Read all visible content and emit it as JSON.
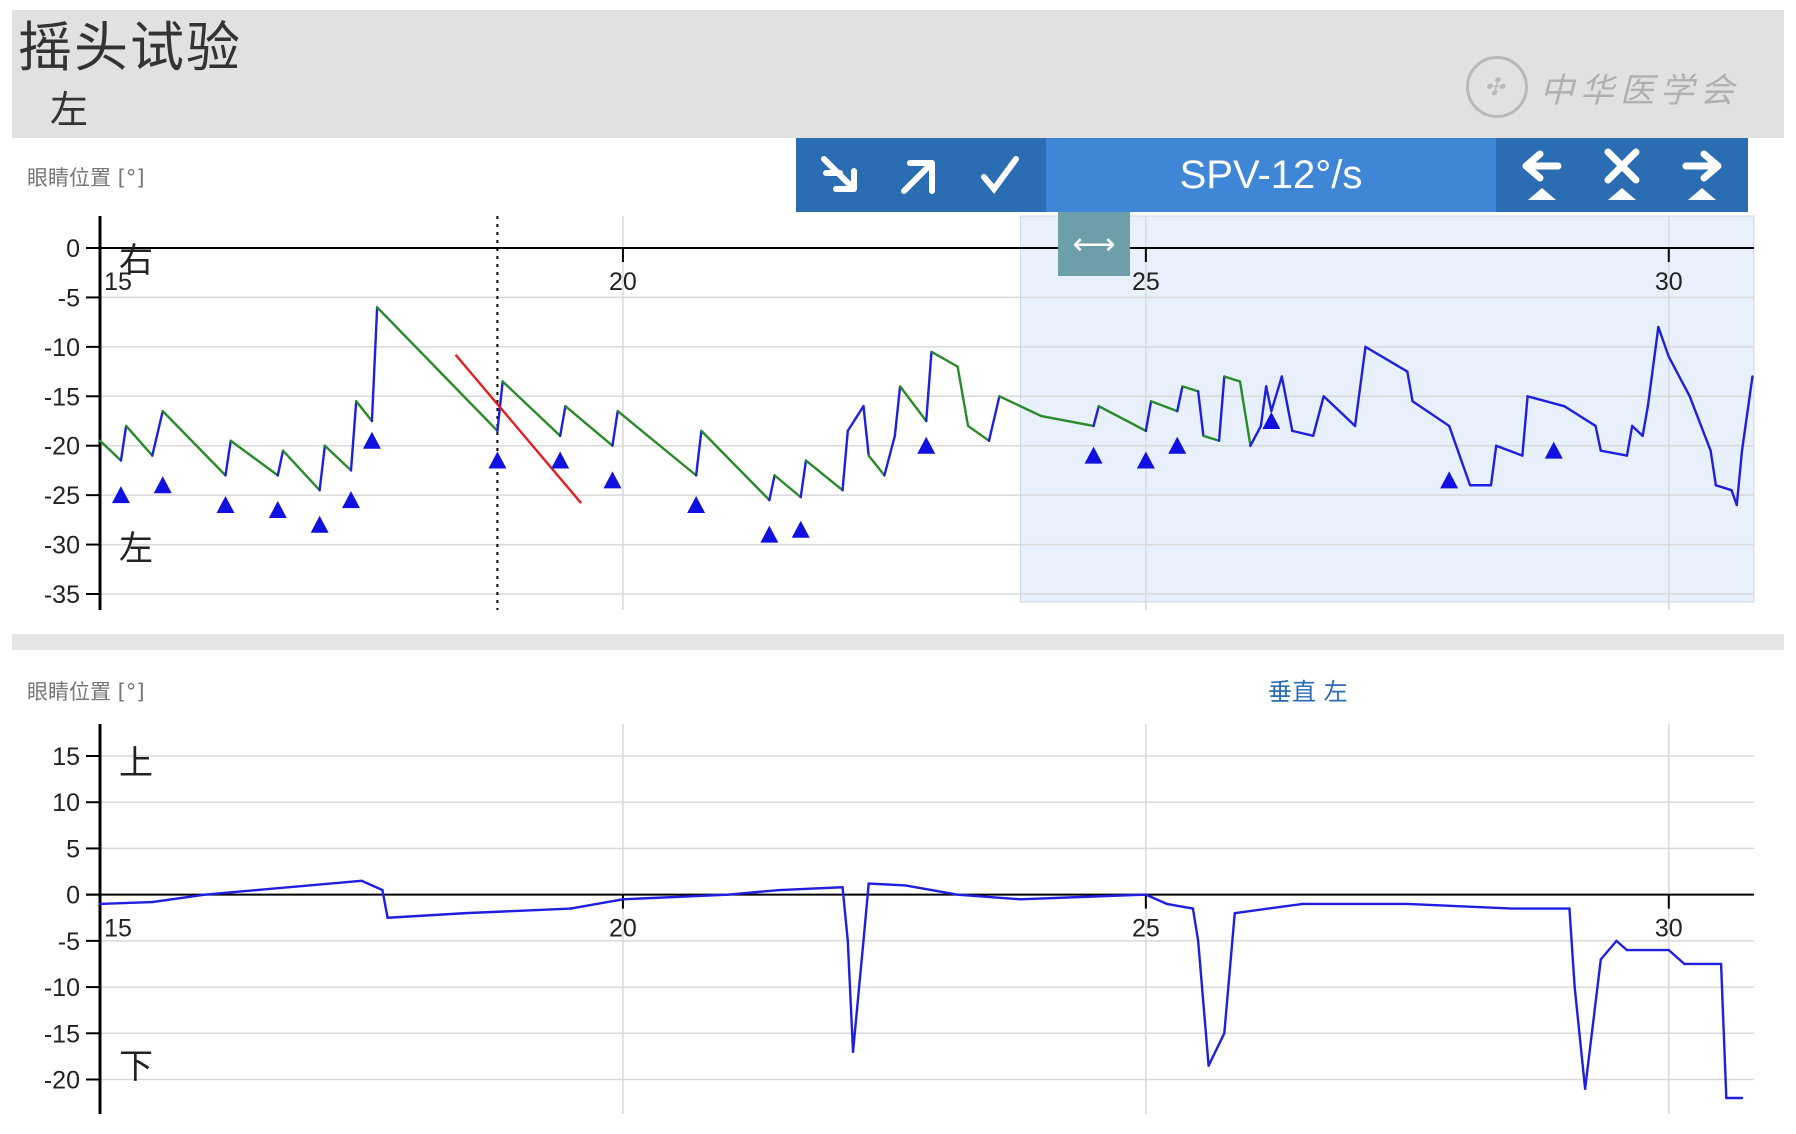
{
  "header": {
    "title": "摇头试验",
    "subtitle": "左",
    "watermark": "中华医学会"
  },
  "toolbar": {
    "spv_label": "SPV-12°/s",
    "left_icons": [
      "arrow-down-left-icon",
      "arrow-up-left-icon",
      "check-icon"
    ],
    "right_icons": [
      "arrow-left-icon",
      "close-icon",
      "arrow-right-icon"
    ],
    "handle_icon": "resize-horizontal-icon"
  },
  "colors": {
    "trace": "#1f1fe0",
    "slow_phase": "#2a8a2a",
    "fit_line": "#e02020",
    "selection": "#e8f1fb",
    "toolbar": "#2b6db3"
  },
  "chart_data": [
    {
      "type": "line",
      "panel": "horizontal",
      "ylabel": "眼睛位置 [°]",
      "ylim": [
        -35,
        0
      ],
      "yticks": [
        0,
        -5,
        -10,
        -15,
        -20,
        -25,
        -30,
        -35
      ],
      "xlim": [
        15,
        30.7
      ],
      "xticks": [
        15,
        20,
        25,
        30
      ],
      "direction_labels": {
        "top": "右",
        "bottom": "左"
      },
      "selection": [
        23.8,
        30.7
      ],
      "marker_line_x": 18.8,
      "fit_line": [
        [
          18.4,
          -10.8
        ],
        [
          19.6,
          -25.8
        ]
      ],
      "triangle_markers": [
        [
          15.2,
          -25
        ],
        [
          15.6,
          -24
        ],
        [
          16.2,
          -26
        ],
        [
          16.7,
          -26.5
        ],
        [
          17.1,
          -28
        ],
        [
          17.4,
          -25.5
        ],
        [
          17.6,
          -19.5
        ],
        [
          18.8,
          -21.5
        ],
        [
          19.4,
          -21.5
        ],
        [
          19.9,
          -23.5
        ],
        [
          20.7,
          -26
        ],
        [
          21.4,
          -29
        ],
        [
          21.7,
          -28.5
        ],
        [
          22.9,
          -20
        ],
        [
          24.5,
          -21
        ],
        [
          25.0,
          -21.5
        ],
        [
          25.3,
          -20
        ],
        [
          26.2,
          -17.5
        ],
        [
          27.9,
          -23.5
        ],
        [
          28.9,
          -20.5
        ]
      ],
      "series": [
        {
          "values": [
            [
              15.0,
              -19.5
            ],
            [
              15.2,
              -21.5
            ],
            [
              15.25,
              -18
            ],
            [
              15.5,
              -21
            ],
            [
              15.6,
              -16.5
            ],
            [
              16.2,
              -23
            ],
            [
              16.25,
              -19.5
            ],
            [
              16.7,
              -23
            ],
            [
              16.75,
              -20.5
            ],
            [
              17.1,
              -24.5
            ],
            [
              17.15,
              -20
            ],
            [
              17.4,
              -22.5
            ],
            [
              17.45,
              -15.5
            ],
            [
              17.6,
              -17.5
            ],
            [
              17.65,
              -6
            ],
            [
              18.8,
              -18.5
            ],
            [
              18.85,
              -13.5
            ],
            [
              19.4,
              -19
            ],
            [
              19.45,
              -16
            ],
            [
              19.9,
              -20
            ],
            [
              19.95,
              -16.5
            ],
            [
              20.7,
              -23
            ],
            [
              20.75,
              -18.5
            ],
            [
              21.4,
              -25.5
            ],
            [
              21.45,
              -23
            ],
            [
              21.7,
              -25.2
            ],
            [
              21.75,
              -21.5
            ],
            [
              22.1,
              -24.5
            ],
            [
              22.15,
              -18.5
            ],
            [
              22.3,
              -16
            ],
            [
              22.35,
              -21
            ],
            [
              22.5,
              -23
            ],
            [
              22.6,
              -19
            ],
            [
              22.65,
              -14
            ],
            [
              22.9,
              -17.5
            ],
            [
              22.95,
              -10.5
            ],
            [
              23.2,
              -12
            ],
            [
              23.3,
              -18
            ],
            [
              23.5,
              -19.5
            ],
            [
              23.6,
              -15
            ],
            [
              24.0,
              -17
            ],
            [
              24.5,
              -18
            ],
            [
              24.55,
              -16
            ],
            [
              25.0,
              -18.5
            ],
            [
              25.05,
              -15.5
            ],
            [
              25.3,
              -16.5
            ],
            [
              25.35,
              -14
            ],
            [
              25.5,
              -14.5
            ],
            [
              25.55,
              -19
            ],
            [
              25.7,
              -19.5
            ],
            [
              25.75,
              -13
            ],
            [
              25.9,
              -13.5
            ],
            [
              26.0,
              -20
            ],
            [
              26.1,
              -18
            ],
            [
              26.15,
              -14
            ],
            [
              26.2,
              -16.5
            ],
            [
              26.3,
              -13
            ],
            [
              26.4,
              -18.5
            ],
            [
              26.6,
              -19
            ],
            [
              26.7,
              -15
            ],
            [
              26.9,
              -17
            ],
            [
              27.0,
              -18
            ],
            [
              27.1,
              -10
            ],
            [
              27.5,
              -12.5
            ],
            [
              27.55,
              -15.5
            ],
            [
              27.9,
              -18
            ],
            [
              28.1,
              -24
            ],
            [
              28.3,
              -24
            ],
            [
              28.35,
              -20
            ],
            [
              28.6,
              -21
            ],
            [
              28.65,
              -15
            ],
            [
              29.0,
              -16
            ],
            [
              29.3,
              -18
            ],
            [
              29.35,
              -20.5
            ],
            [
              29.6,
              -21
            ],
            [
              29.65,
              -18
            ],
            [
              29.75,
              -19
            ],
            [
              29.8,
              -16
            ],
            [
              29.9,
              -8
            ],
            [
              30.0,
              -11
            ],
            [
              30.2,
              -15
            ],
            [
              30.4,
              -20.5
            ],
            [
              30.45,
              -24
            ],
            [
              30.6,
              -24.5
            ],
            [
              30.65,
              -26
            ],
            [
              30.7,
              -20.5
            ],
            [
              30.8,
              -13
            ]
          ]
        }
      ]
    },
    {
      "type": "line",
      "panel": "vertical",
      "title": "垂直 左",
      "ylabel": "眼睛位置 [°]",
      "ylim": [
        -22,
        15
      ],
      "yticks": [
        15,
        10,
        5,
        0,
        -5,
        -10,
        -15,
        -20
      ],
      "xlim": [
        15,
        30.7
      ],
      "xticks": [
        15,
        20,
        25,
        30
      ],
      "direction_labels": {
        "top": "上",
        "bottom": "下"
      },
      "series": [
        {
          "values": [
            [
              15.0,
              -1
            ],
            [
              15.5,
              -0.8
            ],
            [
              16.0,
              0
            ],
            [
              16.5,
              0.5
            ],
            [
              17.0,
              1
            ],
            [
              17.5,
              1.5
            ],
            [
              17.7,
              0.5
            ],
            [
              17.75,
              -2.5
            ],
            [
              18.5,
              -2
            ],
            [
              19.5,
              -1.5
            ],
            [
              20.0,
              -0.5
            ],
            [
              21.0,
              0
            ],
            [
              21.5,
              0.5
            ],
            [
              22.1,
              0.8
            ],
            [
              22.15,
              -5
            ],
            [
              22.2,
              -17
            ],
            [
              22.3,
              -5
            ],
            [
              22.35,
              1.2
            ],
            [
              22.7,
              1
            ],
            [
              23.2,
              0
            ],
            [
              23.8,
              -0.5
            ],
            [
              24.5,
              -0.2
            ],
            [
              25.0,
              0
            ],
            [
              25.2,
              -1
            ],
            [
              25.45,
              -1.5
            ],
            [
              25.5,
              -5
            ],
            [
              25.6,
              -18.5
            ],
            [
              25.75,
              -15
            ],
            [
              25.85,
              -2
            ],
            [
              26.5,
              -1
            ],
            [
              27.5,
              -1
            ],
            [
              28.5,
              -1.5
            ],
            [
              29.05,
              -1.5
            ],
            [
              29.1,
              -10
            ],
            [
              29.2,
              -21
            ],
            [
              29.35,
              -7
            ],
            [
              29.5,
              -5
            ],
            [
              29.6,
              -6
            ],
            [
              30.0,
              -6
            ],
            [
              30.15,
              -7.5
            ],
            [
              30.5,
              -7.5
            ],
            [
              30.55,
              -22
            ],
            [
              30.7,
              -22
            ]
          ]
        }
      ]
    }
  ]
}
